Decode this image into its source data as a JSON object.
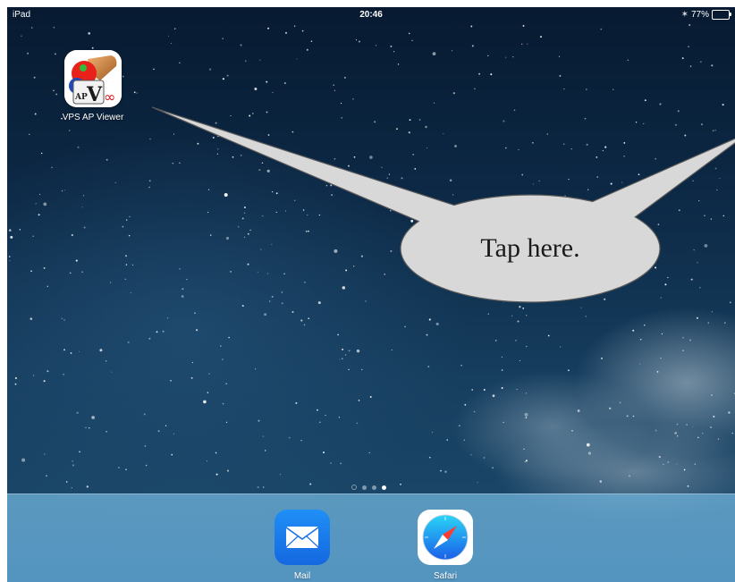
{
  "status_bar": {
    "device": "iPad",
    "time": "20:46",
    "bluetooth_icon": "bluetooth-icon",
    "battery_percent": "77%",
    "battery_level": 0.77,
    "battery_color": "#4cd964"
  },
  "home_screen": {
    "apps": [
      {
        "label": "VPS AP Viewer",
        "icon": "vps-ap-viewer-icon"
      }
    ],
    "page_indicator": {
      "pages": 3,
      "active_page": 3,
      "has_search_page": true
    }
  },
  "callout": {
    "text": "Tap here.",
    "fill": "#d8d8d8",
    "stroke": "#5a5a5a"
  },
  "dock": {
    "apps": [
      {
        "label": "Mail",
        "icon": "mail-icon"
      },
      {
        "label": "Safari",
        "icon": "safari-icon"
      }
    ]
  }
}
